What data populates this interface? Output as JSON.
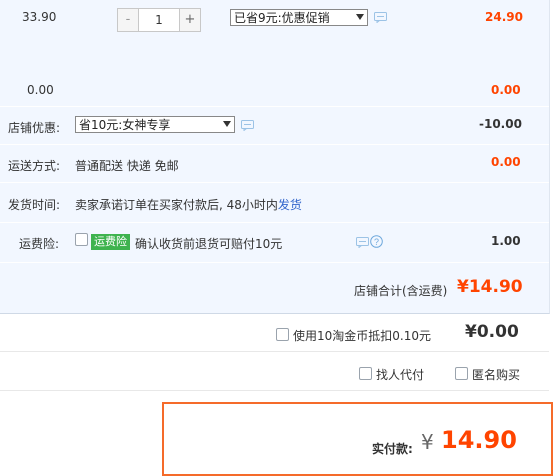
{
  "item": {
    "unit_price": "33.90",
    "quantity": "1",
    "minus": "-",
    "plus": "+",
    "promo_select": "已省9元:优惠促销",
    "item_total": "24.90",
    "sub_value": "0.00",
    "sub_right_value": "0.00"
  },
  "shop_discount": {
    "label": "店铺优惠:",
    "select": "省10元:女神专享",
    "amount": "-10.00"
  },
  "shipping": {
    "label": "运送方式:",
    "value": "普通配送 快递 免邮",
    "amount": "0.00"
  },
  "delivery": {
    "label": "发货时间:",
    "text": "卖家承诺订单在买家付款后, 48小时内",
    "link": "发货"
  },
  "insurance": {
    "label": "运费险:",
    "badge": "运费险",
    "text": "确认收货前退货可赔付10元",
    "amount": "1.00"
  },
  "shop_total": {
    "label": "店铺合计(含运费)",
    "amount": "¥14.90"
  },
  "coins": {
    "label": "使用10淘金币抵扣0.10元",
    "amount": "¥0.00"
  },
  "options": {
    "proxy_pay": "找人代付",
    "anonymous": "匿名购买"
  },
  "payment": {
    "label": "实付款:",
    "currency": "¥",
    "amount": "14.90"
  },
  "colors": {
    "price": "#ff4400",
    "panel": "#f2f7ff",
    "badge": "#3fb34f",
    "link": "#3366cc",
    "pay_border": "#f56b2a"
  },
  "icons": [
    "chat-icon",
    "help-icon",
    "dropdown-arrow-icon"
  ]
}
